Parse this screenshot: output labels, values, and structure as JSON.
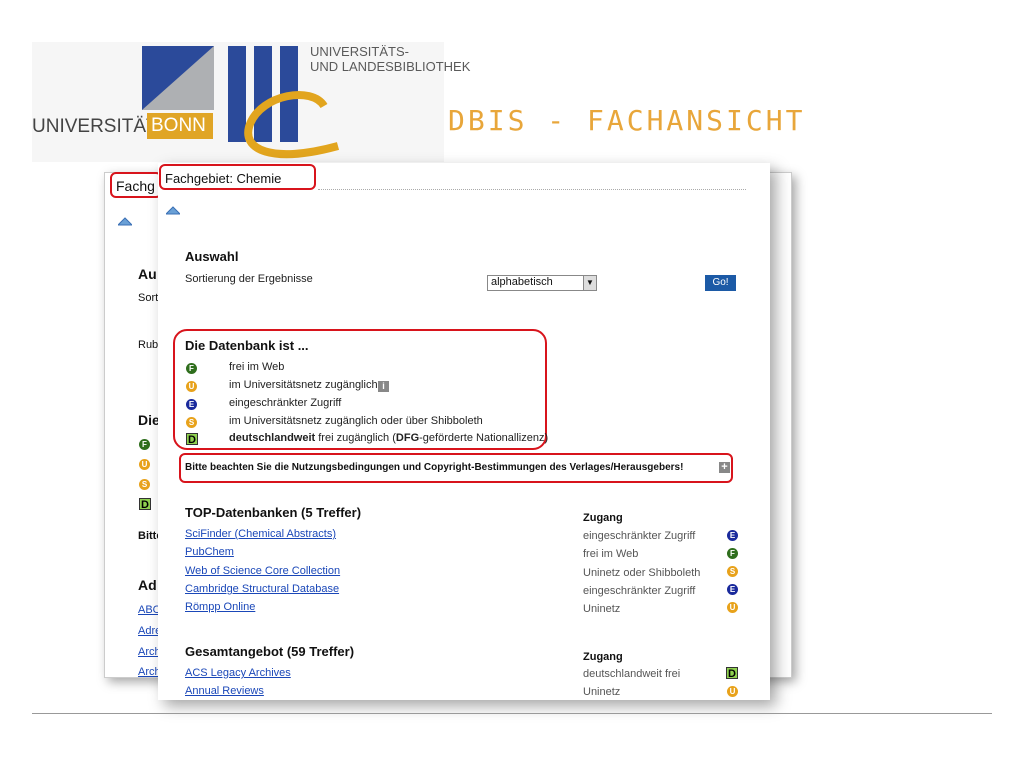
{
  "logo": {
    "university": "UNIVERSITÄT",
    "bonn": "BONN",
    "library_line1": "UNIVERSITÄTS-",
    "library_line2": "UND LANDESBIBLIOTHEK"
  },
  "slide": {
    "title": "DBIS - FACHANSICHT"
  },
  "back_window": {
    "header": "Fachg",
    "lines": [
      "Au",
      "Sort",
      "Rub",
      "Die",
      "Bitte",
      "Ad",
      "ABC",
      "Adre",
      "Arch",
      "Arch"
    ],
    "badges": [
      "F",
      "U",
      "S",
      "D"
    ]
  },
  "front_window": {
    "header": "Fachgebiet: Chemie",
    "auswahl": {
      "title": "Auswahl",
      "sort_label": "Sortierung der Ergebnisse",
      "sort_value": "alphabetisch",
      "go_label": "Go!"
    },
    "legend": {
      "title": "Die Datenbank ist ...",
      "items": [
        {
          "badge": "F",
          "color": "#2f6e1d",
          "text": "frei im Web"
        },
        {
          "badge": "U",
          "color": "#e8a21b",
          "text": "im Universitätsnetz zugänglich"
        },
        {
          "badge": "E",
          "color": "#1a2a9c",
          "text": "eingeschränkter Zugriff"
        },
        {
          "badge": "S",
          "color": "#e8a21b",
          "text": "im Universitätsnetz zugänglich oder über Shibboleth"
        },
        {
          "badge": "D",
          "color": "#8fd14f",
          "text_bold": "deutschlandweit",
          "text_rest": " frei zugänglich (",
          "text_bold2": "DFG",
          "text_rest2": "-geförderte Nationallizenz)"
        }
      ]
    },
    "notice": "Bitte beachten Sie die Nutzungsbedingungen und Copyright-Bestimmungen des Verlages/Herausgebers!",
    "top": {
      "title": "TOP-Datenbanken (5 Treffer)",
      "access_header": "Zugang",
      "rows": [
        {
          "name": "SciFinder (Chemical Abstracts)",
          "access": "eingeschränkter Zugriff",
          "badge": "E",
          "color": "#1a2a9c"
        },
        {
          "name": "PubChem",
          "access": "frei im Web",
          "badge": "F",
          "color": "#2f6e1d"
        },
        {
          "name": "Web of Science Core Collection",
          "access": "Uninetz oder Shibboleth",
          "badge": "S",
          "color": "#e8a21b"
        },
        {
          "name": "Cambridge Structural Database",
          "access": "eingeschränkter Zugriff",
          "badge": "E",
          "color": "#1a2a9c"
        },
        {
          "name": "Römpp Online",
          "access": "Uninetz",
          "badge": "U",
          "color": "#e8a21b"
        }
      ]
    },
    "all": {
      "title": "Gesamtangebot (59 Treffer)",
      "access_header": "Zugang",
      "rows": [
        {
          "name": "ACS Legacy Archives",
          "access": "deutschlandweit frei",
          "badge": "D",
          "color": "#8fd14f"
        },
        {
          "name": "Annual Reviews",
          "access": "Uninetz",
          "badge": "U",
          "color": "#e8a21b"
        }
      ]
    }
  }
}
